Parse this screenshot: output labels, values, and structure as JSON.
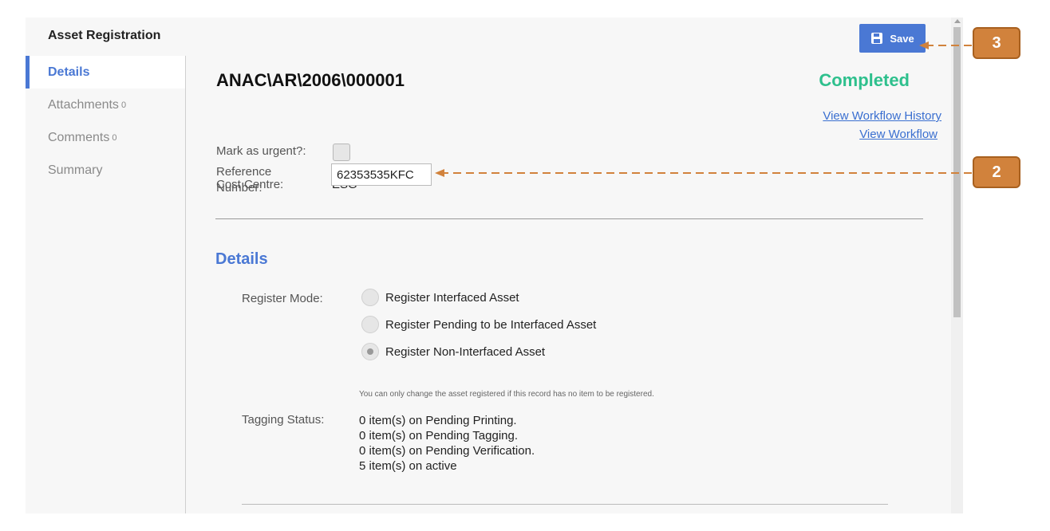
{
  "app": {
    "title": "Asset Registration",
    "save_label": "Save"
  },
  "sidebar": {
    "items": [
      {
        "label": "Details",
        "count": ""
      },
      {
        "label": "Attachments",
        "count": "0"
      },
      {
        "label": "Comments",
        "count": "0"
      },
      {
        "label": "Summary",
        "count": ""
      }
    ]
  },
  "record": {
    "number": "ANAC\\AR\\2006\\000001",
    "status": "Completed",
    "view_workflow_history": "View Workflow History",
    "view_workflow": "View Workflow",
    "urgent_label": "Mark as urgent?:",
    "cost_centre_label": "Cost Centre:",
    "cost_centre_value": "ESG",
    "reference_label_line1": "Reference",
    "reference_label_line2": "Number:",
    "reference_value": "62353535KFC"
  },
  "details": {
    "section_title": "Details",
    "register_mode_label": "Register Mode:",
    "register_options": [
      {
        "label": "Register Interfaced Asset",
        "selected": false
      },
      {
        "label": "Register Pending to be Interfaced Asset",
        "selected": false
      },
      {
        "label": "Register Non-Interfaced Asset",
        "selected": true
      }
    ],
    "note": "You can only change the asset registered if this record has no item to be registered.",
    "tagging_status_label": "Tagging Status:",
    "tagging_status_lines": [
      "0 item(s) on Pending Printing.",
      "0 item(s) on Pending Tagging.",
      "0 item(s) on Pending Verification.",
      "5 item(s) on active"
    ]
  },
  "callouts": {
    "save_callout": "3",
    "reference_callout": "2"
  },
  "colors": {
    "accent": "#4a78d4",
    "status_completed": "#2ec08d",
    "callout": "#d1823c"
  },
  "icons": {
    "save": "floppy-disk-icon"
  }
}
